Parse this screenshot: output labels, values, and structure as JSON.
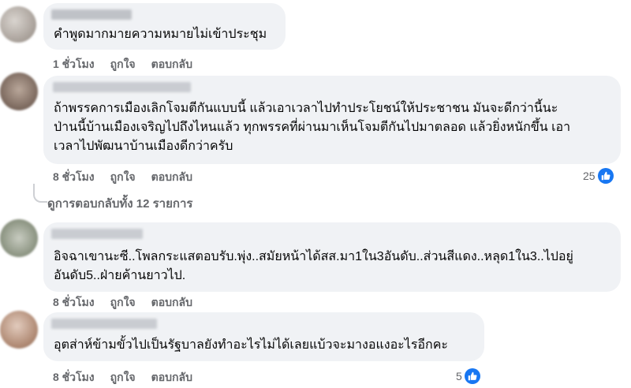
{
  "comments": [
    {
      "text": "คำพูดมากมายความหมายไม่เข้าประชุม",
      "time": "1 ชั่วโมง",
      "like": "ถูกใจ",
      "reply": "ตอบกลับ"
    },
    {
      "text": "ถ้าพรรคการเมืองเลิกโจมตีกันแบบนี้ แล้วเอาเวลาไปทำประโยชน์ให้ประชาชน มันจะดีกว่านี้นะ\nป่านนี้บ้านเมืองเจริญไปถึงไหนแล้ว ทุกพรรคที่ผ่านมาเห็นโจมตีกันไปมาตลอด แล้วยิ่งหนักขึ้น เอา\nเวลาไปพัฒนาบ้านเมืองดีกว่าครับ",
      "time": "8 ชั่วโมง",
      "like": "ถูกใจ",
      "reply": "ตอบกลับ",
      "reactions": "25"
    },
    {
      "text": "อิจฉาเขานะซี..โพลกระแสตอบรับ.พุ่ง..สมัยหน้าได้สส.มา1ใน3อันดับ..ส่วนสีแดง..หลุด1ใน3..ไปอยู่\nอันดับ5..ฝ่ายค้านยาวไป.",
      "time": "8 ชั่วโมง",
      "like": "ถูกใจ",
      "reply": "ตอบกลับ"
    },
    {
      "text": "อุตส่าห์ข้ามขั้วไปเป็นรัฐบาลยังทำอะไรไม่ได้เลยแบ้วจะมางอแงอะไรอีกคะ",
      "time": "8 ชั่วโมง",
      "like": "ถูกใจ",
      "reply": "ตอบกลับ",
      "reactions": "5"
    }
  ],
  "replies_link": "ดูการตอบกลับทั้ง 12 รายการ",
  "colors": {
    "bubble": "#f0f2f5",
    "meta": "#65676b",
    "like_blue": "#1877f2"
  },
  "icons": {
    "like": "thumbs-up-icon"
  }
}
